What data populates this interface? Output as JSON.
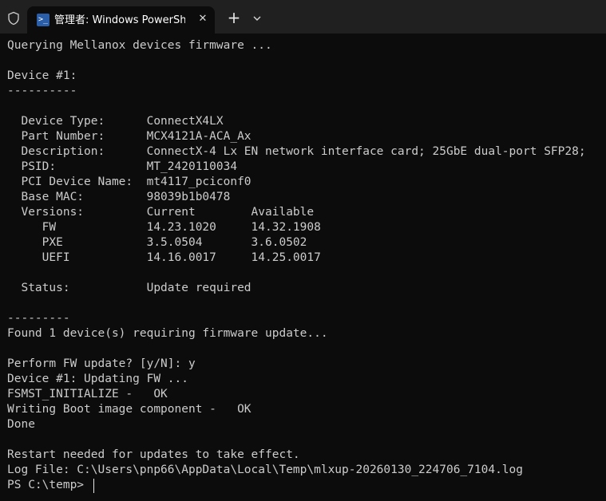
{
  "tab": {
    "title": "管理者: Windows PowerShell",
    "icon_label": ">_",
    "close_glyph": "✕",
    "new_tab_glyph": "+"
  },
  "terminal": {
    "lines": [
      "Querying Mellanox devices firmware ...",
      "",
      "Device #1:",
      "----------",
      "",
      "  Device Type:      ConnectX4LX",
      "  Part Number:      MCX4121A-ACA_Ax",
      "  Description:      ConnectX-4 Lx EN network interface card; 25GbE dual-port SFP28;",
      "  PSID:             MT_2420110034",
      "  PCI Device Name:  mt4117_pciconf0",
      "  Base MAC:         98039b1b0478",
      "  Versions:         Current        Available",
      "     FW             14.23.1020     14.32.1908",
      "     PXE            3.5.0504       3.6.0502",
      "     UEFI           14.16.0017     14.25.0017",
      "",
      "  Status:           Update required",
      "",
      "---------",
      "Found 1 device(s) requiring firmware update...",
      "",
      "Perform FW update? [y/N]: y",
      "Device #1: Updating FW ...",
      "FSMST_INITIALIZE -   OK",
      "Writing Boot image component -   OK",
      "Done",
      "",
      "Restart needed for updates to take effect.",
      "Log File: C:\\Users\\pnp66\\AppData\\Local\\Temp\\mlxup-20260130_224706_7104.log",
      "PS C:\\temp> "
    ]
  }
}
